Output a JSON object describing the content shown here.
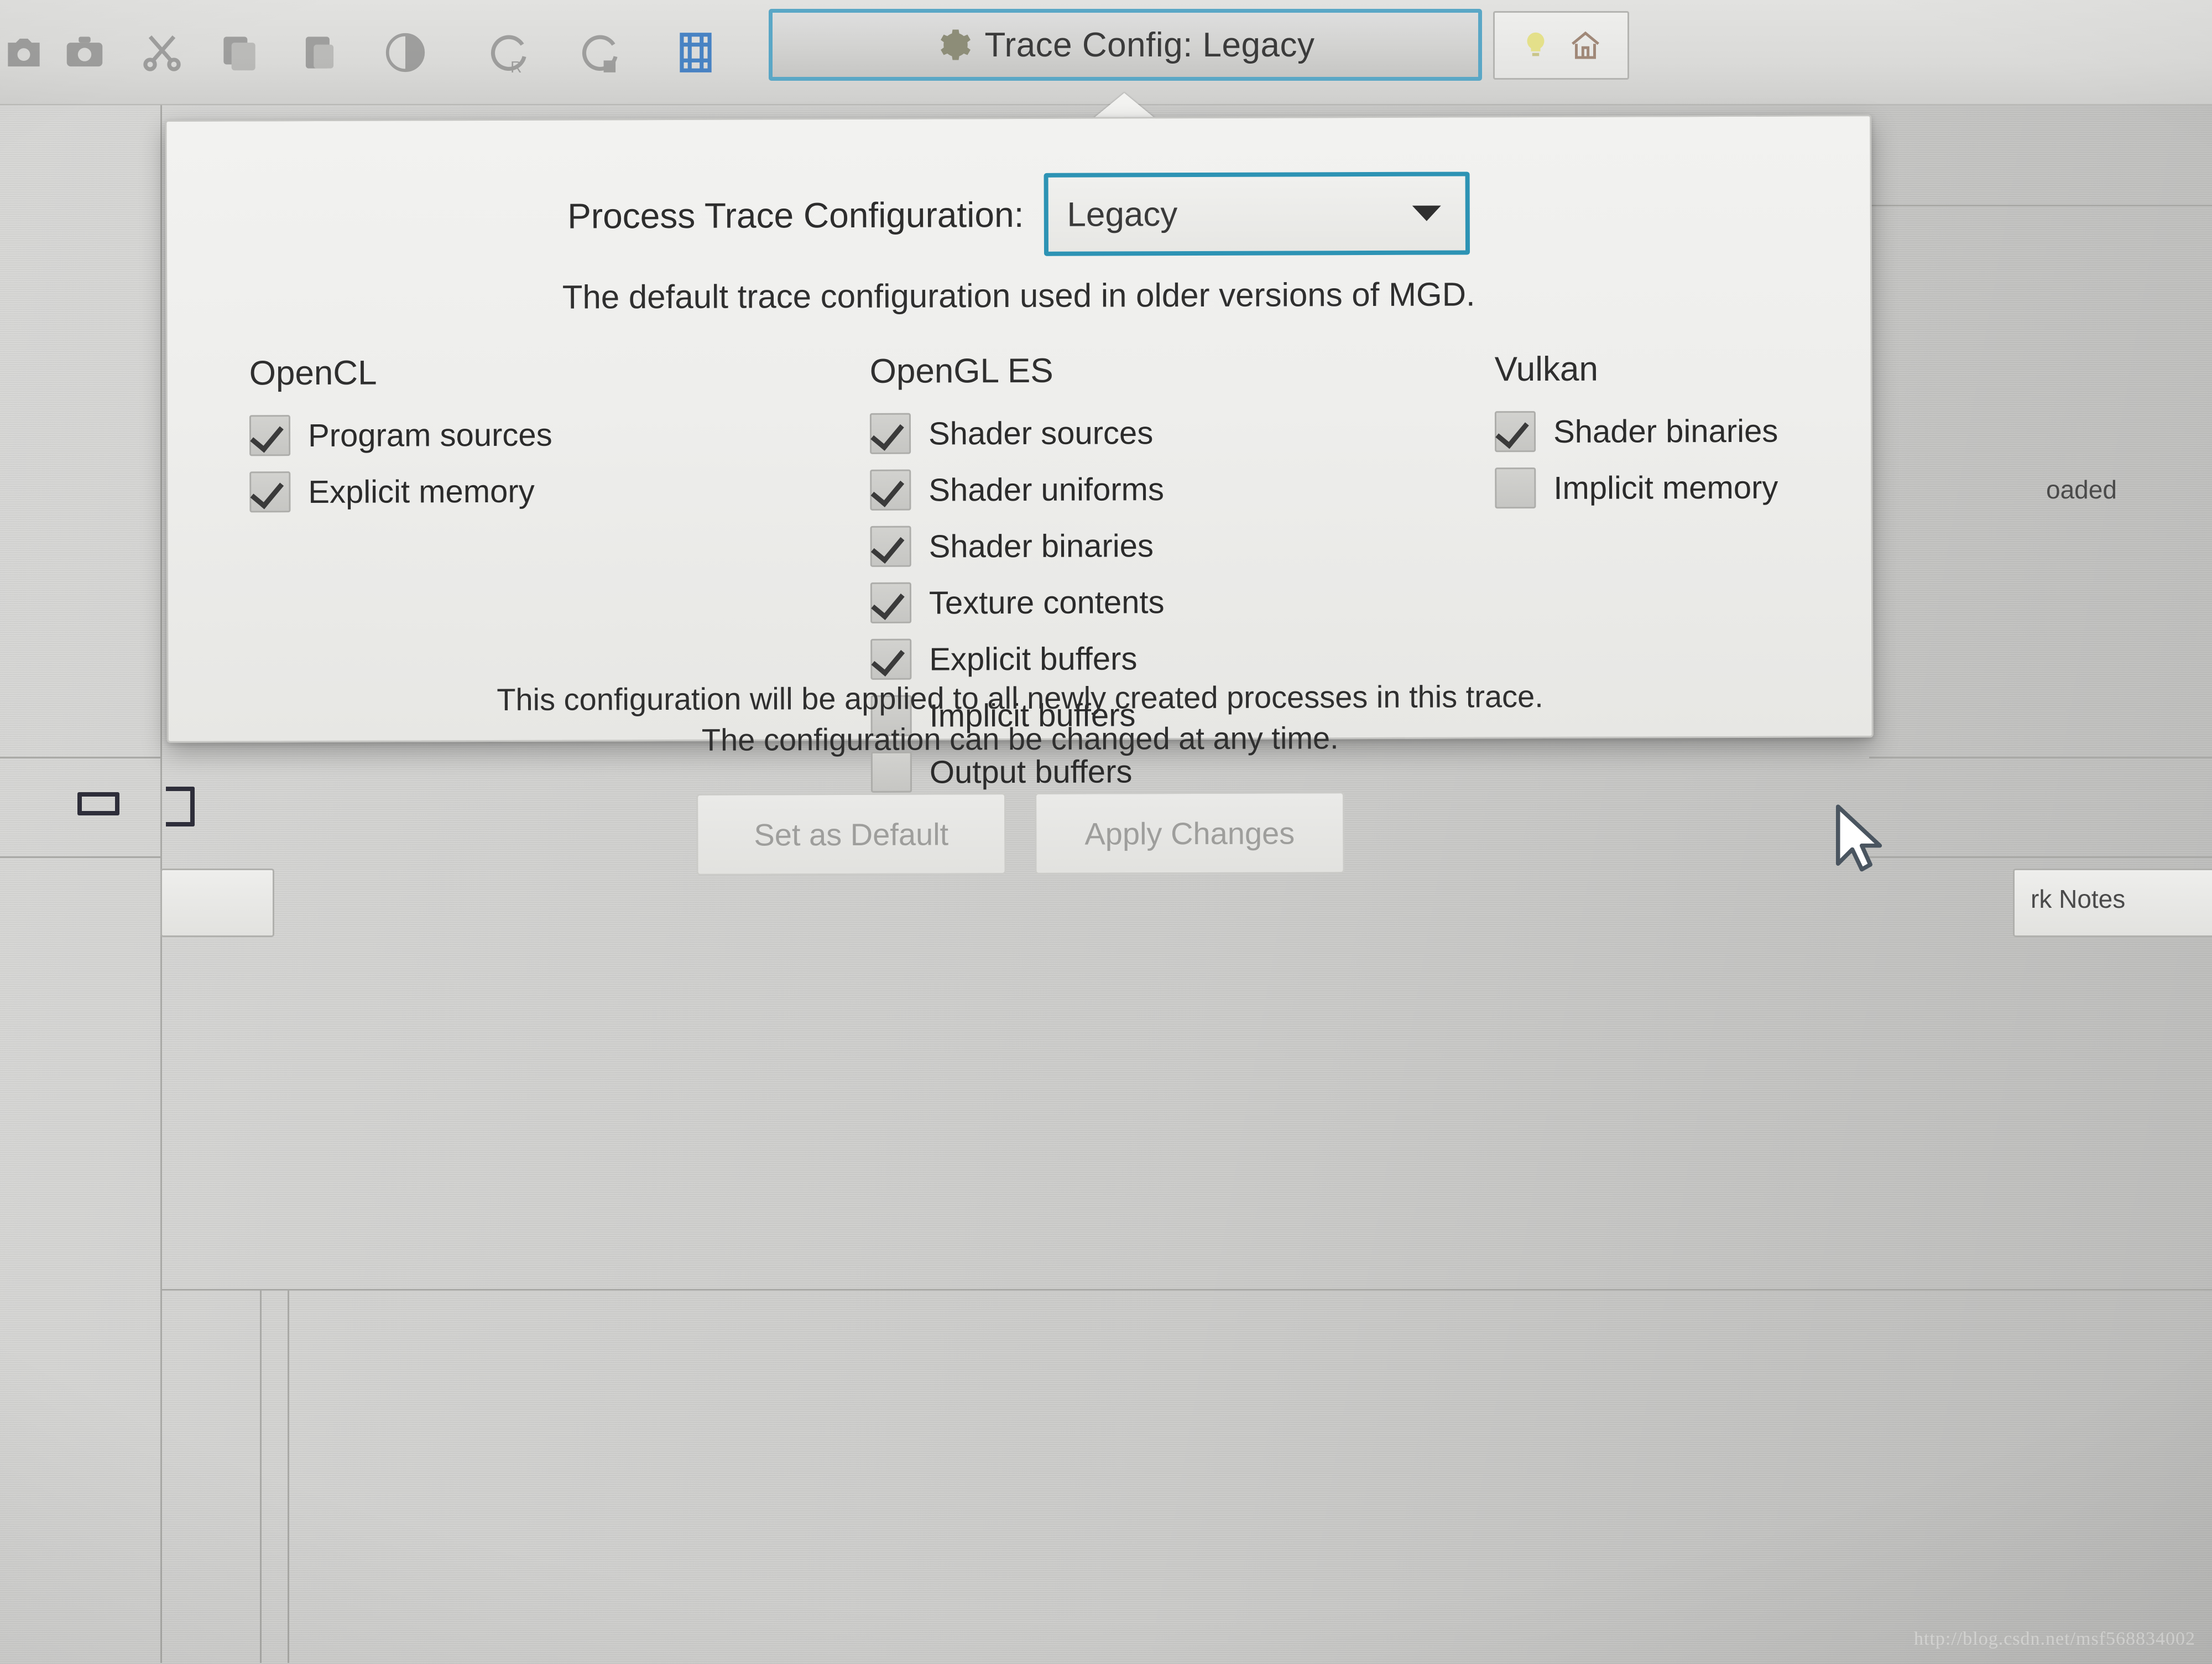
{
  "toolbar": {
    "icons": [
      {
        "name": "camera-icon",
        "glyph": "camera"
      },
      {
        "name": "screenshot-icon",
        "glyph": "screenshot"
      },
      {
        "name": "scissors-icon",
        "glyph": "scissors"
      },
      {
        "name": "copy-frame-icon",
        "glyph": "copy"
      },
      {
        "name": "paste-frame-icon",
        "glyph": "paste"
      },
      {
        "name": "record-icon",
        "glyph": "record"
      },
      {
        "name": "capture-replay-icon",
        "glyph": "c-r"
      },
      {
        "name": "capture-d-icon",
        "glyph": "c-d"
      },
      {
        "name": "filmstrip-icon",
        "glyph": "filmstrip"
      }
    ],
    "active_tab": {
      "label": "Trace Config: Legacy",
      "icon": "gear-icon",
      "accent_color": "#5aa7c6"
    },
    "side_buttons": [
      {
        "name": "bulb-icon",
        "glyph": "bulb"
      },
      {
        "name": "home-icon",
        "glyph": "home"
      }
    ]
  },
  "dialog": {
    "config_label": "Process Trace Configuration:",
    "config_value": "Legacy",
    "config_options": [
      "Legacy"
    ],
    "description": "The default trace configuration used in older versions of MGD.",
    "columns": [
      {
        "title": "OpenCL",
        "items": [
          {
            "label": "Program sources",
            "checked": true
          },
          {
            "label": "Explicit memory",
            "checked": true
          }
        ]
      },
      {
        "title": "OpenGL ES",
        "items": [
          {
            "label": "Shader sources",
            "checked": true
          },
          {
            "label": "Shader uniforms",
            "checked": true
          },
          {
            "label": "Shader binaries",
            "checked": true
          },
          {
            "label": "Texture contents",
            "checked": true
          },
          {
            "label": "Explicit buffers",
            "checked": true
          },
          {
            "label": "Implicit buffers",
            "checked": false
          },
          {
            "label": "Output buffers",
            "checked": false
          }
        ]
      },
      {
        "title": "Vulkan",
        "items": [
          {
            "label": "Shader binaries",
            "checked": true
          },
          {
            "label": "Implicit memory",
            "checked": false
          }
        ]
      }
    ],
    "footnote_line1": "This configuration will be applied to all newly created processes in this trace.",
    "footnote_line2": "The configuration can be changed at any time.",
    "buttons": [
      {
        "label": "Set as Default",
        "enabled": false
      },
      {
        "label": "Apply Changes",
        "enabled": false
      }
    ],
    "accent_color": "#2d93b4"
  },
  "background": {
    "right_text_partial": "oaded",
    "right_button_partial": "rk Notes"
  },
  "watermark": "http://blog.csdn.net/msf568834002"
}
